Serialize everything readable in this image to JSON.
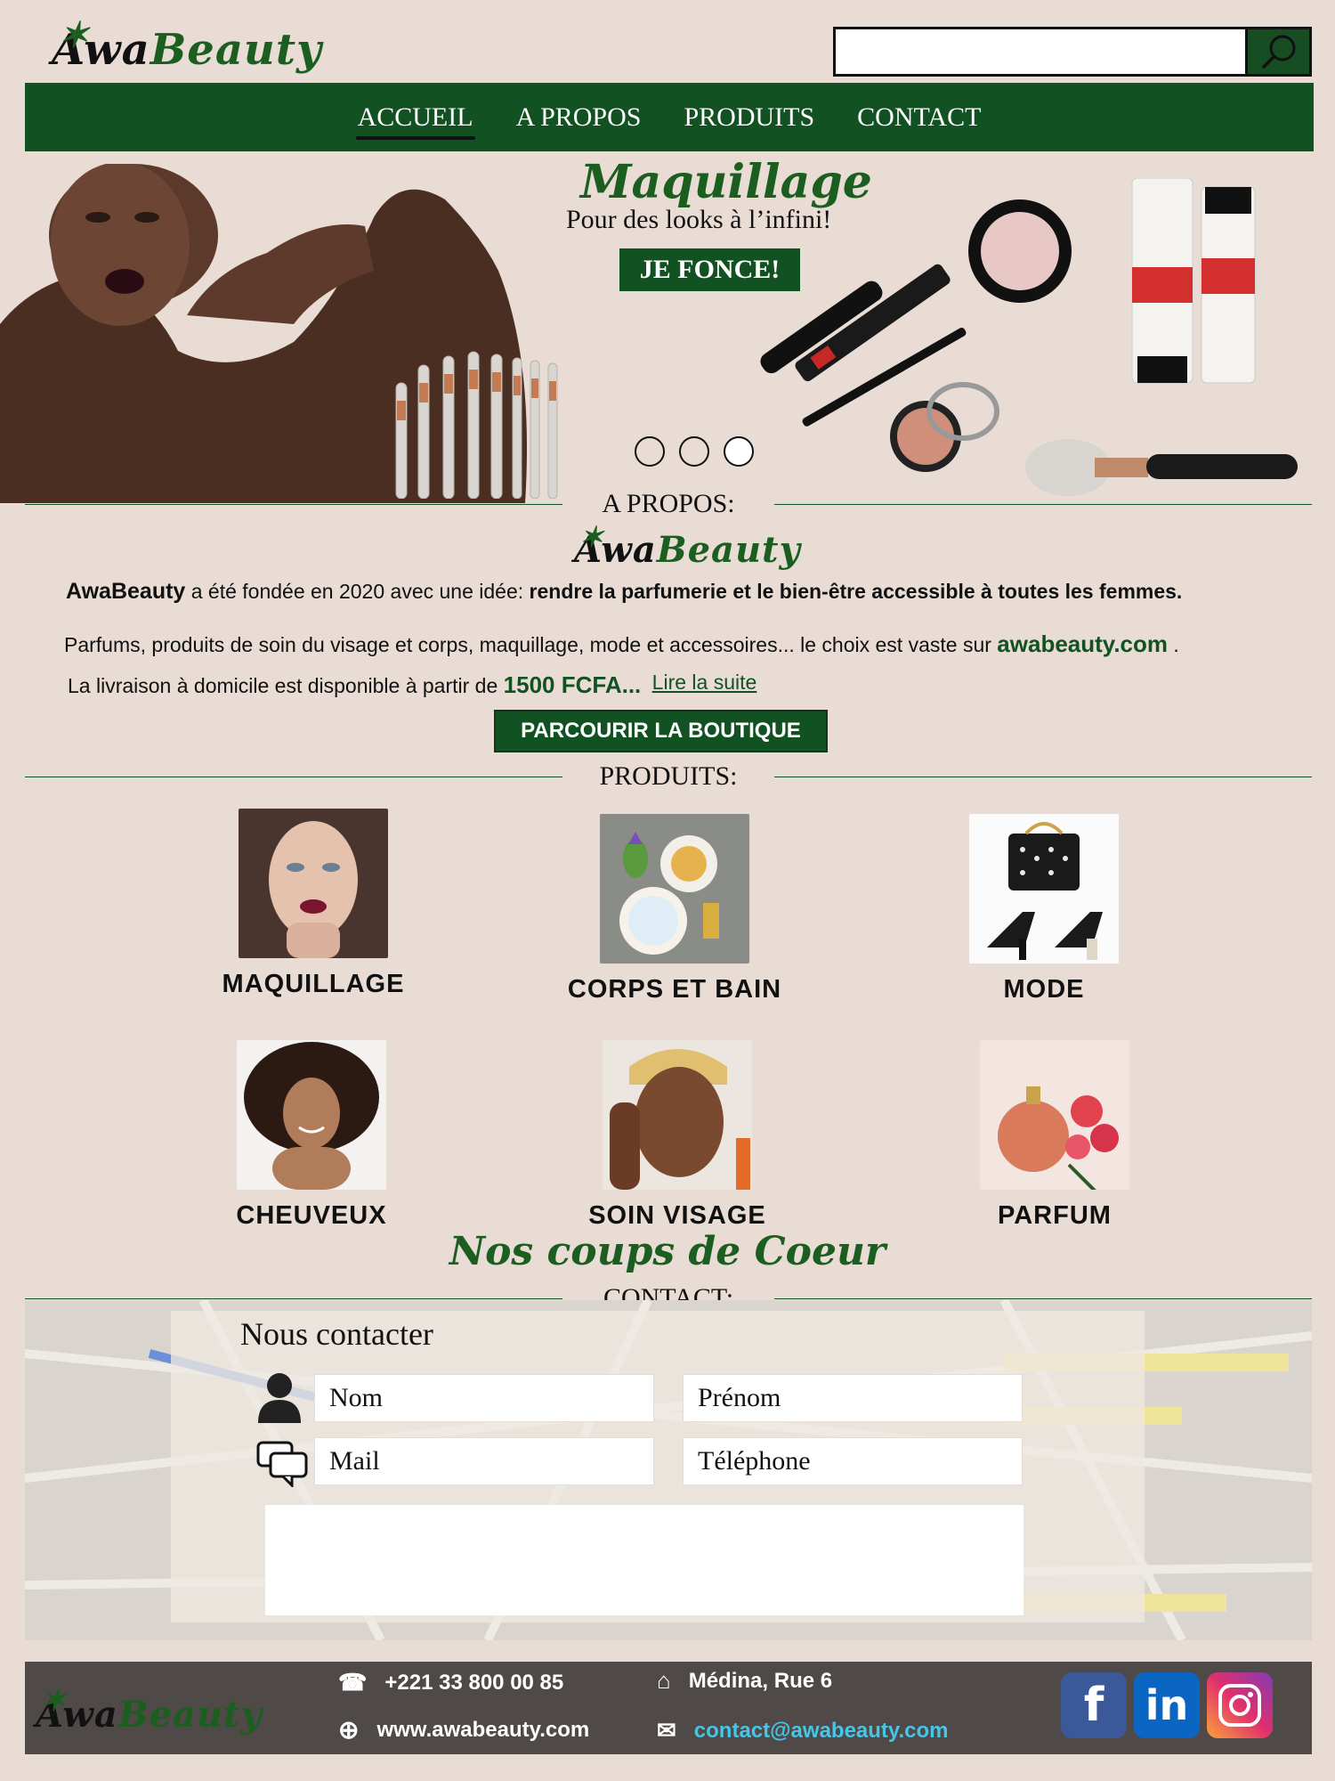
{
  "brand": {
    "logo_part1": "Awa",
    "logo_part2": "Beauty"
  },
  "search": {
    "value": "",
    "placeholder": ""
  },
  "nav": {
    "items": [
      "ACCUEIL",
      "A PROPOS",
      "PRODUITS",
      "CONTACT"
    ],
    "active": "ACCUEIL"
  },
  "hero": {
    "title": "Maquillage",
    "subtitle": "Pour des looks à l’infini!",
    "cta": "JE FONCE!",
    "slides": 3,
    "active_slide": 3
  },
  "about": {
    "heading": "A PROPOS:",
    "line1_brand": "AwaBeauty",
    "line1_text": " a été fondée en 2020 avec une idée: ",
    "line1_bold": "rendre la parfumerie et le bien-être accessible à toutes les femmes.",
    "line2_text": "Parfums, produits de soin du visage et corps, maquillage, mode et accessoires... le choix est vaste sur ",
    "line2_link": "awabeauty.com",
    "line2_end": " .",
    "line3_text": "La livraison à domicile est disponible à partir de ",
    "line3_price": "1500 FCFA...",
    "read_more": "Lire la suite",
    "shop_button": "PARCOURIR LA BOUTIQUE"
  },
  "products": {
    "heading": "PRODUITS:",
    "items": [
      {
        "name": "MAQUILLAGE"
      },
      {
        "name": "CORPS ET BAIN"
      },
      {
        "name": "MODE"
      },
      {
        "name": "CHEUVEUX"
      },
      {
        "name": "SOIN VISAGE"
      },
      {
        "name": "PARFUM"
      }
    ]
  },
  "coups": {
    "title": "Nos coups de Coeur"
  },
  "contact": {
    "heading": "CONTACT:",
    "title": "Nous contacter",
    "fields": {
      "nom": "Nom",
      "prenom": "Prénom",
      "mail": "Mail",
      "telephone": "Téléphone"
    },
    "message": ""
  },
  "footer": {
    "phone": "+221 33 800 00 85",
    "address": "Médina, Rue 6",
    "website": "www.awabeauty.com",
    "email": "contact@awabeauty.com"
  },
  "colors": {
    "brand_green": "#125222",
    "background": "#e8dcd4",
    "footer": "#4f4a48",
    "link_blue": "#45c6e6"
  }
}
